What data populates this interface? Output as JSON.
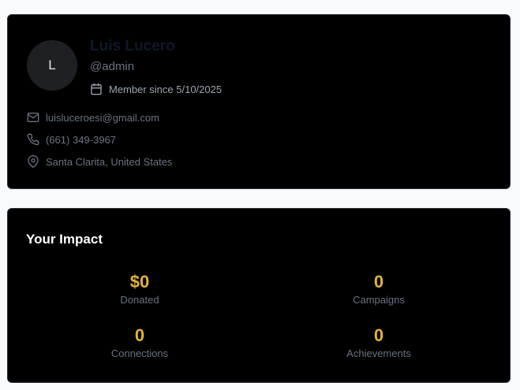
{
  "profile": {
    "avatar_initial": "L",
    "name": "Luis Lucero",
    "username": "@admin",
    "member_since": "Member since 5/10/2025",
    "email": "luisluceroesi@gmail.com",
    "phone": "(661) 349-3967",
    "location": "Santa Clarita, United States",
    "icons": [
      "calendar-icon",
      "mail-icon",
      "phone-icon",
      "map-pin-icon"
    ]
  },
  "impact": {
    "title": "Your Impact",
    "stats": [
      {
        "value": "$0",
        "label": "Donated"
      },
      {
        "value": "0",
        "label": "Campaigns"
      },
      {
        "value": "0",
        "label": "Connections"
      },
      {
        "value": "0",
        "label": "Achievements"
      }
    ]
  },
  "colors": {
    "background": "#f8fafc",
    "card": "#000000",
    "accent": "#e3b23c",
    "muted_text": "#6b7280"
  }
}
